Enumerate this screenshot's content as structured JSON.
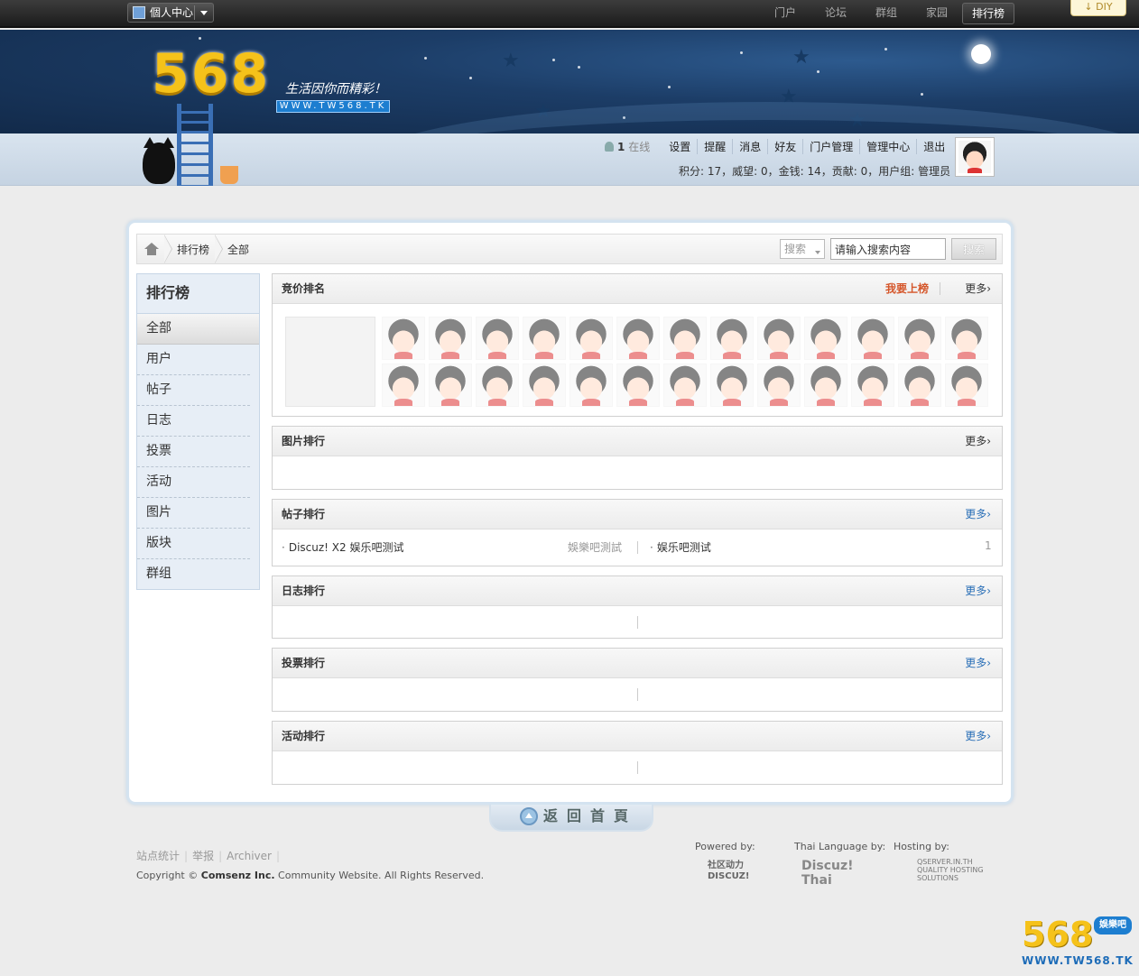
{
  "topbar": {
    "user_center": "個人中心",
    "nav": [
      "门户",
      "论坛",
      "群组",
      "家园",
      "排行榜"
    ],
    "active_nav": "排行榜",
    "diy": "DIY"
  },
  "header": {
    "logo": "568",
    "slogan": "生活因你而精彩！",
    "url": "WWW.TW568.TK"
  },
  "user": {
    "online_count": "1",
    "online_label": "在线",
    "links": [
      "设置",
      "提醒",
      "消息",
      "好友",
      "门户管理",
      "管理中心",
      "退出"
    ],
    "credits": "积分: 17，威望: 0，金钱: 14，贡献: 0，用户组: 管理员"
  },
  "breadcrumb": {
    "items": [
      "排行榜",
      "全部"
    ]
  },
  "search": {
    "type_label": "搜索",
    "value": "请输入搜索内容",
    "button": "搜索"
  },
  "sidebar": {
    "title": "排行榜",
    "items": [
      "全部",
      "用户",
      "帖子",
      "日志",
      "投票",
      "活动",
      "图片",
      "版块",
      "群组"
    ]
  },
  "sections": {
    "bid": {
      "title": "竞价排名",
      "want": "我要上榜",
      "more": "更多›"
    },
    "pics": {
      "title": "图片排行",
      "more": "更多›"
    },
    "threads": {
      "title": "帖子排行",
      "more": "更多›",
      "rows": [
        {
          "title": "Discuz! X2 娱乐吧测试",
          "extra": "娛樂吧測試"
        },
        {
          "title": "娱乐吧测试",
          "extra": "1"
        }
      ]
    },
    "blogs": {
      "title": "日志排行",
      "more": "更多›"
    },
    "polls": {
      "title": "投票排行",
      "more": "更多›"
    },
    "events": {
      "title": "活动排行",
      "more": "更多›"
    }
  },
  "footer": {
    "back_home": "返回首頁",
    "links": [
      "站点统计",
      "举报",
      "Archiver"
    ],
    "copyright_prefix": "Copyright ©",
    "copyright_company": "Comsenz Inc.",
    "copyright_suffix": "Community Website. All Rights Reserved.",
    "powered_by": "Powered by:",
    "thai_by": "Thai Language by:",
    "hosting_by": "Hosting by:",
    "logo1": "社区动力 DISCUZ!",
    "logo2": "Discuz! Thai",
    "logo3": "QSERVER.IN.TH QUALITY HOSTING SOLUTIONS"
  },
  "watermark": {
    "num": "568",
    "tag": "娛樂吧",
    "url": "WWW.TW568.TK"
  }
}
